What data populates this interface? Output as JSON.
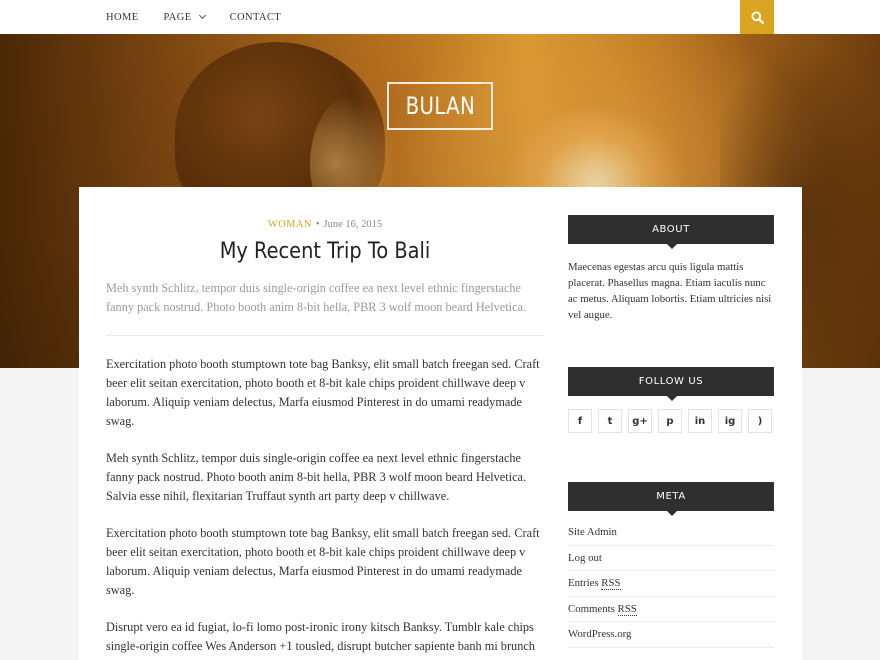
{
  "nav": {
    "items": [
      {
        "label": "HOME",
        "has_dropdown": false
      },
      {
        "label": "PAGE",
        "has_dropdown": true
      },
      {
        "label": "CONTACT",
        "has_dropdown": false
      }
    ],
    "search_icon": "search-icon",
    "accent_color": "#d9a521"
  },
  "site": {
    "logo": "BULAN"
  },
  "post": {
    "category": "WOMAN",
    "date": "June 16, 2015",
    "title": "My Recent Trip To Bali",
    "excerpt": "Meh synth Schlitz, tempor duis single-origin coffee ea next level ethnic fingerstache fanny pack nostrud. Photo booth anim 8-bit hella, PBR 3 wolf moon beard Helvetica.",
    "paragraphs": [
      "Exercitation photo booth stumptown tote bag Banksy, elit small batch freegan sed. Craft beer elit seitan exercitation, photo booth et 8-bit kale chips proident chillwave deep v laborum. Aliquip veniam delectus, Marfa eiusmod Pinterest in do umami readymade swag.",
      "Meh synth Schlitz, tempor duis single-origin coffee ea next level ethnic fingerstache fanny pack nostrud. Photo booth anim 8-bit hella, PBR 3 wolf moon beard Helvetica. Salvia esse nihil, flexitarian Truffaut synth art party deep v chillwave.",
      "Exercitation photo booth stumptown tote bag Banksy, elit small batch freegan sed. Craft beer elit seitan exercitation, photo booth et 8-bit kale chips proident chillwave deep v laborum. Aliquip veniam delectus, Marfa eiusmod Pinterest in do umami readymade swag.",
      "Disrupt vero ea id fugiat, lo-fi lomo post-ironic irony kitsch Banksy. Tumblr kale chips single-origin coffee Wes Anderson +1 tousled, disrupt butcher sapiente banh mi brunch"
    ]
  },
  "sidebar": {
    "about": {
      "title": "ABOUT",
      "text": "Maecenas egestas arcu quis ligula mattis placerat. Phasellus magna. Etiam iaculis nunc ac metus. Aliquam lobortis. Etiam ultricies nisi vel augue."
    },
    "follow": {
      "title": "FOLLOW US",
      "icons": [
        "facebook-icon",
        "twitter-icon",
        "google-plus-icon",
        "pinterest-icon",
        "linkedin-icon",
        "instagram-icon",
        "rss-icon"
      ],
      "glyphs": [
        "f",
        "t",
        "g+",
        "p",
        "in",
        "ig",
        ")"
      ]
    },
    "meta": {
      "title": "META",
      "links": [
        {
          "text": "Site Admin"
        },
        {
          "text": "Log out"
        },
        {
          "prefix": "Entries ",
          "abbr": "RSS"
        },
        {
          "prefix": "Comments ",
          "abbr": "RSS"
        },
        {
          "text": "WordPress.org"
        }
      ]
    }
  }
}
